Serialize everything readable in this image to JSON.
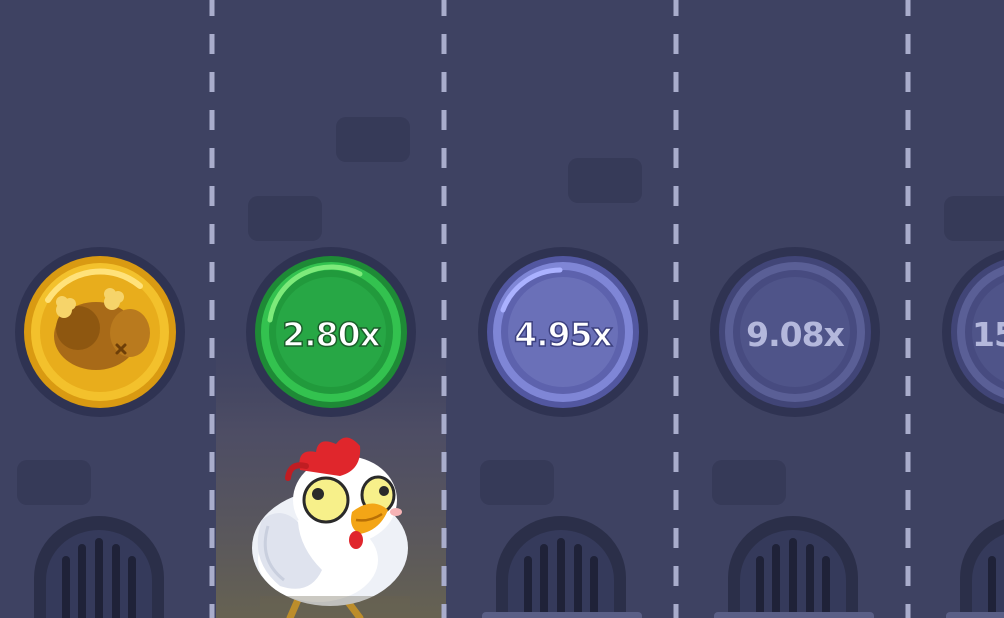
{
  "game": {
    "lanes": [
      {
        "state": "lost-coin",
        "multiplier": "",
        "icon": "cooked-chicken-icon"
      },
      {
        "state": "active",
        "multiplier": "2.80x"
      },
      {
        "state": "next",
        "multiplier": "4.95x"
      },
      {
        "state": "upcoming",
        "multiplier": "9.08x"
      },
      {
        "state": "upcoming-partial",
        "multiplier": "15"
      }
    ],
    "player": {
      "icon": "chicken-character-icon"
    },
    "colors": {
      "background": "#3e4262",
      "lane_divider": "#a9adcc",
      "coin_gold": "#f3c12c",
      "coin_green": "#27a745",
      "coin_blue": "#6a70b8",
      "coin_dim": "#4f5489"
    }
  }
}
